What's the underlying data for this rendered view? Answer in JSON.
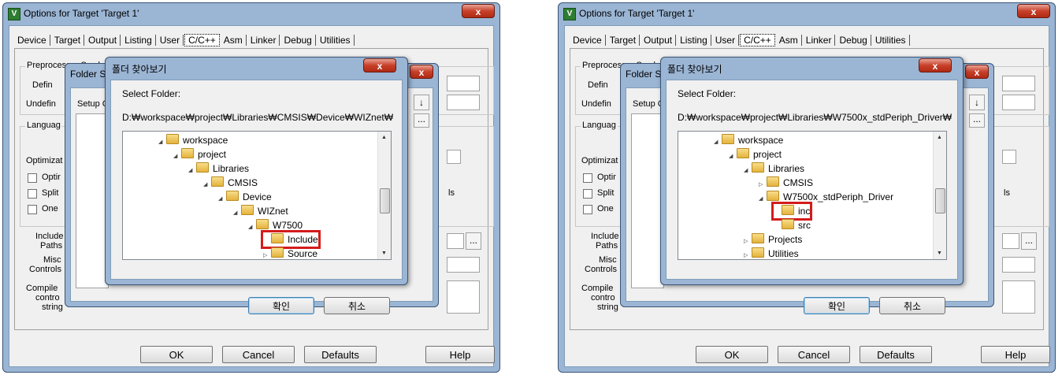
{
  "window_title": "Options for Target 'Target 1'",
  "tabs": [
    "Device",
    "Target",
    "Output",
    "Listing",
    "User",
    "C/C++",
    "Asm",
    "Linker",
    "Debug",
    "Utilities"
  ],
  "selected_tab": "C/C++",
  "close_glyph": "x",
  "bg_labels": {
    "preprocessor": "Preprocessor Symb",
    "define": "Defin",
    "undefine": "Undefin",
    "language": "Languag",
    "optimization": "Optimizat",
    "opt1": "Optir",
    "opt2": "Split",
    "opt3": "One",
    "include": "Include",
    "paths": "Paths",
    "misc": "Misc",
    "controls": "Controls",
    "compiler": "Compile",
    "control": "contro",
    "string": "string",
    "ls": "ls"
  },
  "folder_setup": {
    "title": "Folder S",
    "setup_label": "Setup C",
    "browse": "...",
    "arrow": "↓"
  },
  "bottom_buttons": {
    "ok": "OK",
    "cancel": "Cancel",
    "defaults": "Defaults",
    "help": "Help"
  },
  "browse_dialog": {
    "title": "폴더 찾아보기",
    "select_label": "Select Folder:",
    "ok": "확인",
    "cancel": "취소"
  },
  "panels": [
    {
      "path": "D:₩workspace₩project₩Libraries₩CMSIS₩Device₩WIZnet₩",
      "tree": [
        {
          "label": "workspace",
          "expander": "◢",
          "indent": 3
        },
        {
          "label": "project",
          "expander": "◢",
          "indent": 4
        },
        {
          "label": "Libraries",
          "expander": "◢",
          "indent": 5
        },
        {
          "label": "CMSIS",
          "expander": "◢",
          "indent": 6
        },
        {
          "label": "Device",
          "expander": "◢",
          "indent": 7
        },
        {
          "label": "WIZnet",
          "expander": "◢",
          "indent": 8
        },
        {
          "label": "W7500",
          "expander": "◢",
          "indent": 9
        },
        {
          "label": "Include",
          "expander": "",
          "indent": 10,
          "highlight": true
        },
        {
          "label": "Source",
          "expander": "▷",
          "indent": 10
        }
      ]
    },
    {
      "path": "D:₩workspace₩project₩Libraries₩W7500x_stdPeriph_Driver₩",
      "tree": [
        {
          "label": "workspace",
          "expander": "◢",
          "indent": 3
        },
        {
          "label": "project",
          "expander": "◢",
          "indent": 4
        },
        {
          "label": "Libraries",
          "expander": "◢",
          "indent": 5
        },
        {
          "label": "CMSIS",
          "expander": "▷",
          "indent": 6
        },
        {
          "label": "W7500x_stdPeriph_Driver",
          "expander": "◢",
          "indent": 6
        },
        {
          "label": "inc",
          "expander": "",
          "indent": 7,
          "highlight": true
        },
        {
          "label": "src",
          "expander": "",
          "indent": 7
        },
        {
          "label": "Projects",
          "expander": "▷",
          "indent": 5
        },
        {
          "label": "Utilities",
          "expander": "▷",
          "indent": 5
        }
      ]
    }
  ],
  "colors": {
    "highlight": "#d41b1b",
    "titlebar": "#9bb5d4",
    "folder": "#e4b33c"
  }
}
